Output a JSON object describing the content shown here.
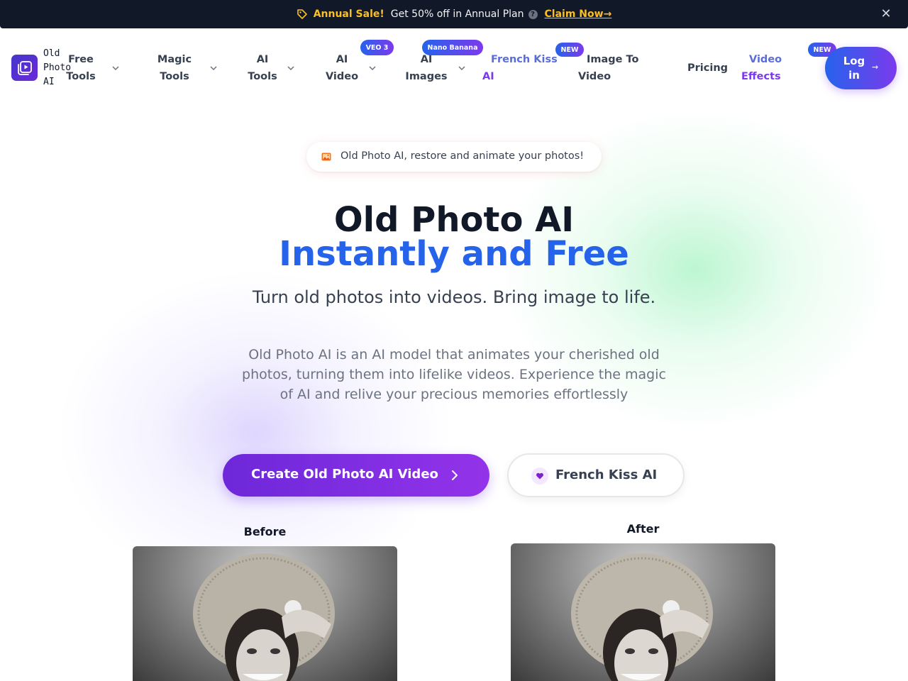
{
  "announcement": {
    "sale_label": "Annual Sale!",
    "offer_text": "Get 50% off in Annual Plan",
    "help_glyph": "?",
    "claim_label": "Claim Now",
    "claim_arrow": "→",
    "close_glyph": "✕"
  },
  "brand": {
    "line1": "Old",
    "line2": "Photo",
    "line3": "AI"
  },
  "nav": {
    "free_tools": [
      "Free",
      "Tools"
    ],
    "magic_tools": [
      "Magic",
      "Tools"
    ],
    "ai_tools": [
      "AI",
      "Tools"
    ],
    "ai_video": [
      "AI",
      "Video"
    ],
    "ai_video_badge": "VEO 3",
    "ai_images": [
      "AI",
      "Images"
    ],
    "ai_images_badge": "Nano Banana",
    "french_kiss": [
      "French Kiss",
      "AI"
    ],
    "french_kiss_badge": "NEW",
    "image_to_video": [
      "Image To",
      "Video"
    ],
    "pricing": "Pricing",
    "video_effects": [
      "Video",
      "Effects"
    ],
    "video_effects_badge": "NEW",
    "login": [
      "Log",
      "in"
    ],
    "login_arrow": "→"
  },
  "hero": {
    "pill_text": "Old Photo AI, restore and animate your photos!",
    "title_line1": "Old Photo AI",
    "title_line2": "Instantly and Free",
    "subtitle": "Turn old photos into videos. Bring image to life.",
    "description": "Old Photo AI is an AI model that animates your cherished old photos, turning them into lifelike videos. Experience the magic of AI and relive your precious memories effortlessly",
    "primary_cta": "Create Old Photo AI Video",
    "secondary_cta": "French Kiss AI"
  },
  "comparison": {
    "before_label": "Before",
    "after_label": "After"
  },
  "colors": {
    "accent_blue": "#2563eb",
    "accent_purple": "#7c3aed",
    "sale_yellow": "#fbbf24",
    "topbar_bg": "#111827"
  },
  "icons": {
    "sale": "tag-icon",
    "help": "help-circle-icon",
    "close": "close-icon",
    "logo": "play-frame-icon",
    "dropdown": "chevron-down-icon",
    "pill": "image-icon",
    "cta_arrow": "chevron-right-icon",
    "secondary_cta": "heart-icon"
  }
}
